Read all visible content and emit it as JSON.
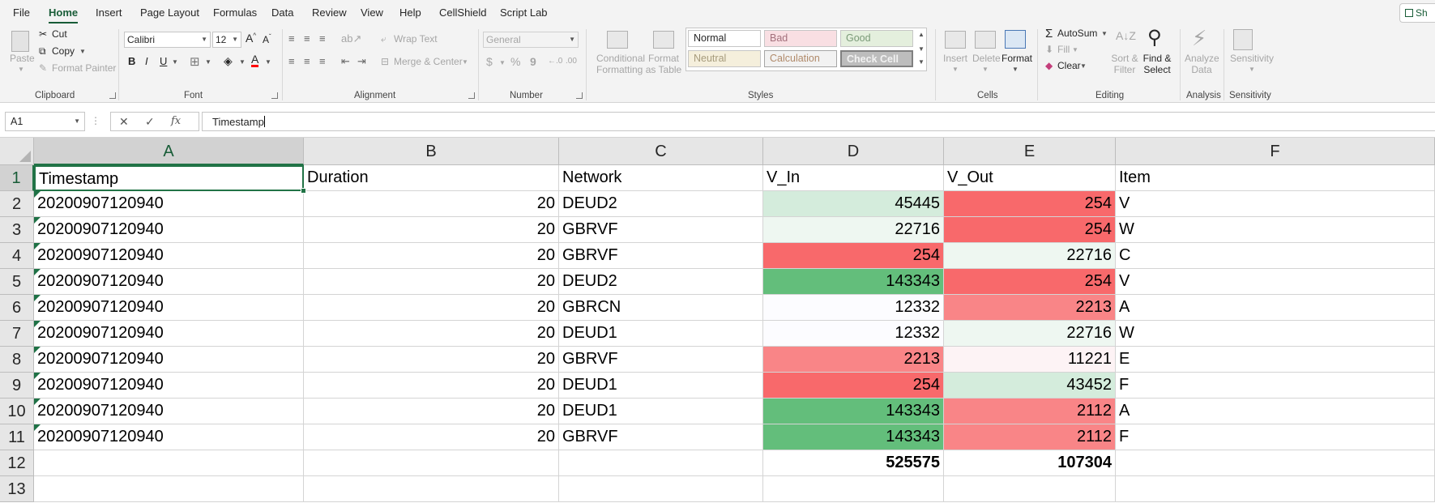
{
  "menu": {
    "tabs": [
      "File",
      "Home",
      "Insert",
      "Page Layout",
      "Formulas",
      "Data",
      "Review",
      "View",
      "Help",
      "CellShield",
      "Script Lab"
    ],
    "active": "Home",
    "share_label": "Sh"
  },
  "ribbon": {
    "clipboard": {
      "label": "Clipboard",
      "paste": "Paste",
      "cut": "Cut",
      "copy": "Copy",
      "format_painter": "Format Painter"
    },
    "font": {
      "label": "Font",
      "family": "Calibri",
      "size": "12",
      "bold": "B",
      "italic": "I",
      "underline": "U"
    },
    "alignment": {
      "label": "Alignment",
      "wrap_text": "Wrap Text",
      "merge_center": "Merge & Center"
    },
    "number": {
      "label": "Number",
      "format": "General",
      "currency": "$",
      "percent": "%",
      "comma": "9"
    },
    "styles": {
      "label": "Styles",
      "conditional_formatting": "Conditional Formatting",
      "format_as_table": "Format as Table",
      "cells": [
        "Normal",
        "Bad",
        "Good",
        "Neutral",
        "Calculation",
        "Check Cell"
      ]
    },
    "cells": {
      "label": "Cells",
      "insert": "Insert",
      "delete": "Delete",
      "format": "Format"
    },
    "editing": {
      "label": "Editing",
      "autosum": "AutoSum",
      "fill": "Fill",
      "clear": "Clear",
      "sort_filter": "Sort & Filter",
      "find_select": "Find & Select"
    },
    "analysis": {
      "label": "Analysis",
      "analyze_data": "Analyze Data"
    },
    "sensitivity": {
      "label": "Sensitivity",
      "button": "Sensitivity"
    }
  },
  "formula_bar": {
    "name_box": "A1",
    "fx": "fx",
    "value": "Timestamp"
  },
  "colors": {
    "accent": "#217346",
    "red_strong": "#f8696b",
    "red_mid": "#f98587",
    "red_light": "#fcfcff",
    "green_strong": "#63be7b",
    "green_light": "#d4ecdc",
    "green_faint": "#eef7f1"
  },
  "sheet": {
    "columns": [
      "A",
      "B",
      "C",
      "D",
      "E",
      "F"
    ],
    "selected_column": "A",
    "selected_row": "1",
    "row_numbers": [
      "1",
      "2",
      "3",
      "4",
      "5",
      "6",
      "7",
      "8",
      "9",
      "10",
      "11",
      "12",
      "13"
    ],
    "headers": [
      "Timestamp",
      "Duration",
      "Network",
      "V_In",
      "V_Out",
      "Item"
    ],
    "rows": [
      [
        "20200907120940",
        "20",
        "DEUD2",
        "45445",
        "254",
        "V"
      ],
      [
        "20200907120940",
        "20",
        "GBRVF",
        "22716",
        "254",
        "W"
      ],
      [
        "20200907120940",
        "20",
        "GBRVF",
        "254",
        "22716",
        "C"
      ],
      [
        "20200907120940",
        "20",
        "DEUD2",
        "143343",
        "254",
        "V"
      ],
      [
        "20200907120940",
        "20",
        "GBRCN",
        "12332",
        "2213",
        "A"
      ],
      [
        "20200907120940",
        "20",
        "DEUD1",
        "12332",
        "22716",
        "W"
      ],
      [
        "20200907120940",
        "20",
        "GBRVF",
        "2213",
        "11221",
        "E"
      ],
      [
        "20200907120940",
        "20",
        "DEUD1",
        "254",
        "43452",
        "F"
      ],
      [
        "20200907120940",
        "20",
        "DEUD1",
        "143343",
        "2112",
        "A"
      ],
      [
        "20200907120940",
        "20",
        "GBRVF",
        "143343",
        "2112",
        "F"
      ]
    ],
    "totals": [
      "",
      "",
      "",
      "525575",
      "107304",
      ""
    ],
    "d_colors": [
      "#d4ecdc",
      "#eef7f1",
      "#f8696b",
      "#63be7b",
      "#fcfcff",
      "#fcfcff",
      "#f98587",
      "#f8696b",
      "#63be7b",
      "#63be7b"
    ],
    "e_colors": [
      "#f8696b",
      "#f8696b",
      "#eef7f1",
      "#f8696b",
      "#f98587",
      "#eef7f1",
      "#fdf3f5",
      "#d4ecdc",
      "#f98587",
      "#f98587"
    ]
  }
}
